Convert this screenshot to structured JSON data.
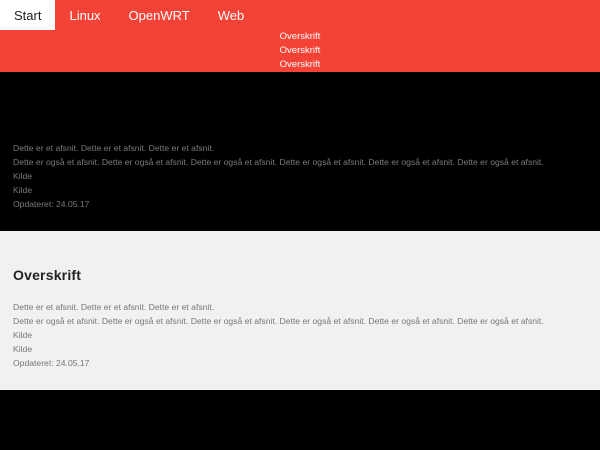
{
  "nav": {
    "tabs": [
      {
        "label": "Start",
        "active": true
      },
      {
        "label": "Linux",
        "active": false
      },
      {
        "label": "OpenWRT",
        "active": false
      },
      {
        "label": "Web",
        "active": false
      }
    ]
  },
  "hero": {
    "links": [
      "Overskrift",
      "Overskrift",
      "Overskrift"
    ]
  },
  "sections": [
    {
      "heading": "",
      "p1": "Dette er et afsnit. Dette er et afsnit. Dette er et afsnit.",
      "p2": "Dette er også et afsnit. Dette er også et afsnit. Dette er også et afsnit. Dette er også et afsnit. Dette er også et afsnit. Dette er også et afsnit.",
      "source1": "Kilde",
      "source2": "Kilde",
      "updated": "Opdateret: 24.05.17"
    },
    {
      "heading": "Overskrift",
      "p1": "Dette er et afsnit. Dette er et afsnit. Dette er et afsnit.",
      "p2": "Dette er også et afsnit. Dette er også et afsnit. Dette er også et afsnit. Dette er også et afsnit. Dette er også et afsnit. Dette er også et afsnit.",
      "source1": "Kilde",
      "source2": "Kilde",
      "updated": "Opdateret: 24.05.17"
    }
  ],
  "colors": {
    "accent": "#f44336",
    "dark_section": "#000000",
    "light_section": "#f1f1f1"
  }
}
